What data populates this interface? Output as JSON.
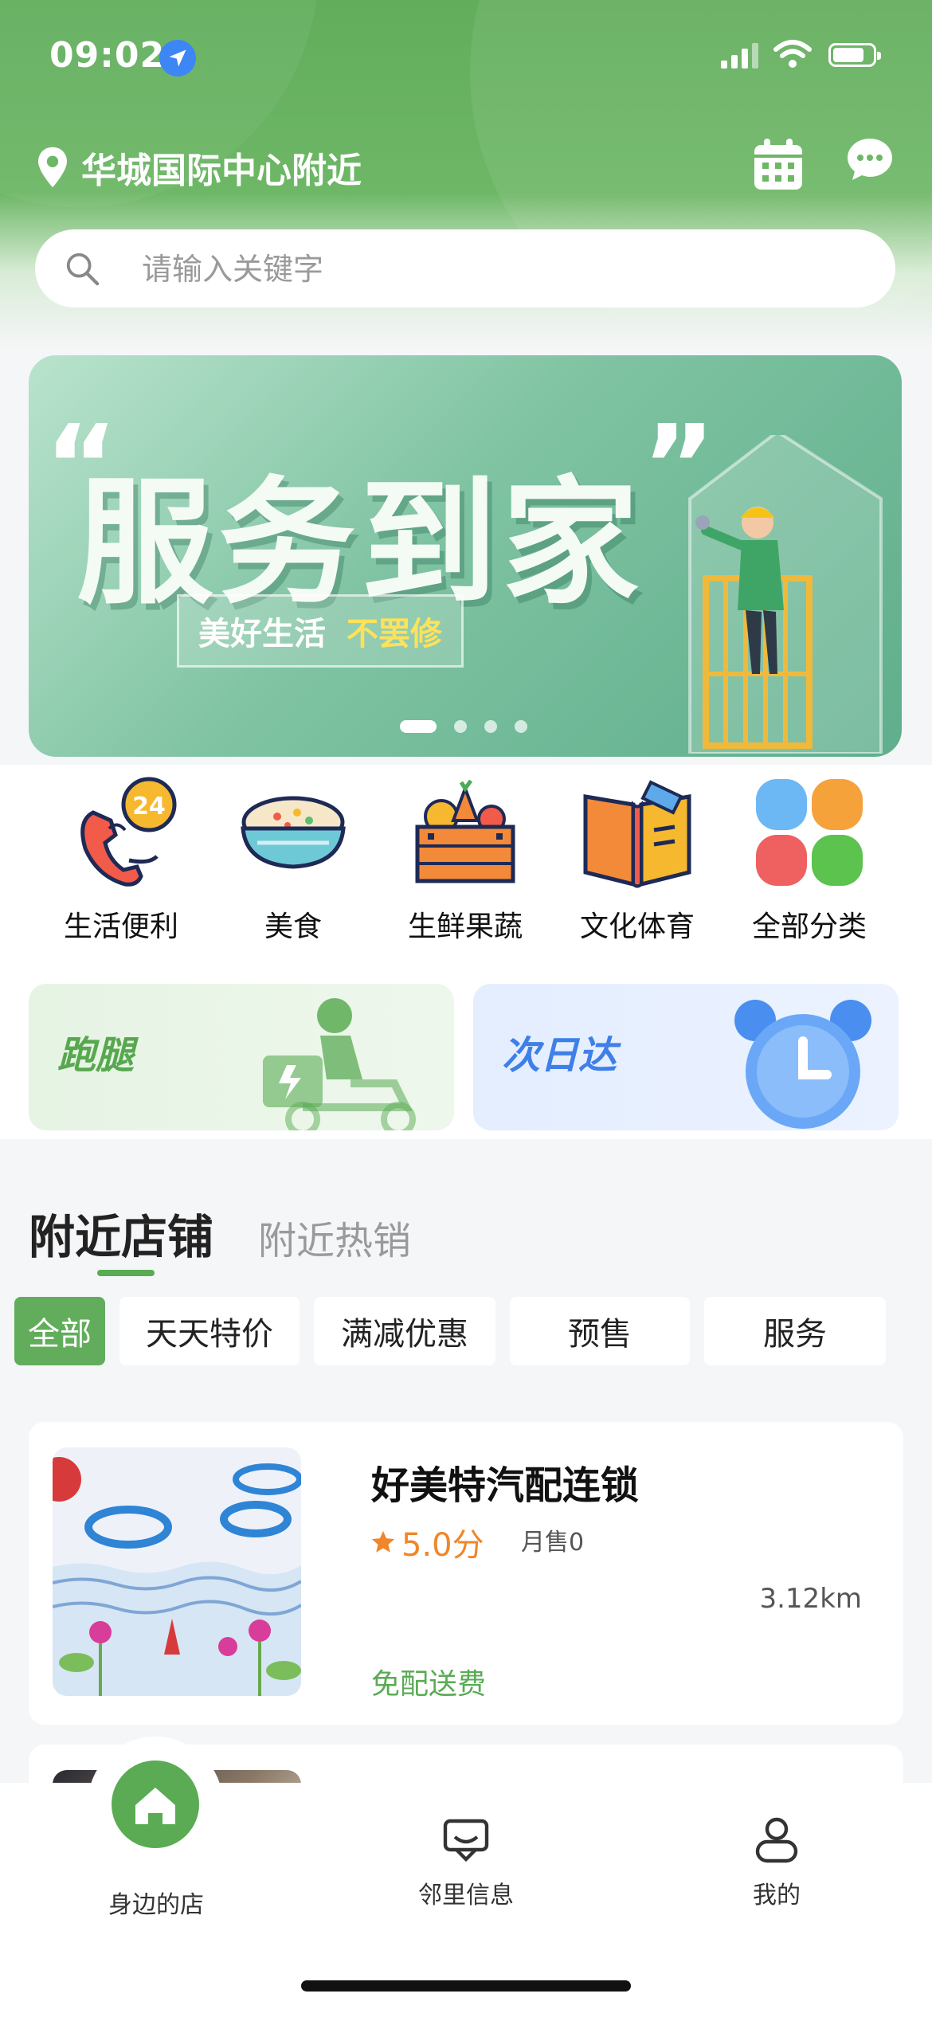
{
  "status_bar": {
    "time": "09:02"
  },
  "header": {
    "location": "华城国际中心附近"
  },
  "search": {
    "placeholder": "请输入关键字"
  },
  "banner": {
    "title": "服务到家",
    "tag_left": "美好生活",
    "tag_right": "不罢修",
    "page_count": 4,
    "active_page": 1
  },
  "categories": [
    {
      "label": "生活便利",
      "icon": "phone-24-icon"
    },
    {
      "label": "美食",
      "icon": "food-bowl-icon"
    },
    {
      "label": "生鲜果蔬",
      "icon": "vegetable-crate-icon"
    },
    {
      "label": "文化体育",
      "icon": "book-icon"
    },
    {
      "label": "全部分类",
      "icon": "grid-icon"
    }
  ],
  "promos": {
    "run": {
      "title": "跑腿",
      "icon": "delivery-rider-icon"
    },
    "next_day": {
      "title": "次日达",
      "icon": "alarm-clock-icon"
    }
  },
  "nearby": {
    "tabs": [
      "附近店铺",
      "附近热销"
    ],
    "filters": [
      "全部",
      "天天特价",
      "满减优惠",
      "预售",
      "服务"
    ],
    "active_filter": "全部"
  },
  "stores": [
    {
      "name": "好美特汽配连锁",
      "rating": "5.0分",
      "monthly_sales": "月售0",
      "distance": "3.12km",
      "delivery": "免配送费"
    }
  ],
  "bottom_nav": [
    {
      "label": "身边的店",
      "icon": "home-icon",
      "active": true
    },
    {
      "label": "邻里信息",
      "icon": "message-board-icon",
      "active": false
    },
    {
      "label": "我的",
      "icon": "user-icon",
      "active": false
    }
  ],
  "colors": {
    "brand_green": "#62ad5c",
    "rating_orange": "#f0862a",
    "next_day_blue": "#3f7fe8"
  }
}
